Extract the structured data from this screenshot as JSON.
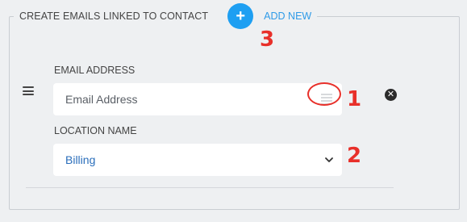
{
  "section": {
    "title": "CREATE EMAILS LINKED TO CONTACT",
    "add_button_icon": "+",
    "add_label": "ADD NEW"
  },
  "email_field": {
    "label": "EMAIL ADDRESS",
    "placeholder": "Email Address",
    "value": ""
  },
  "location_field": {
    "label": "LOCATION NAME",
    "selected": "Billing"
  },
  "annotations": {
    "one": "1",
    "two": "2",
    "three": "3"
  },
  "icons": {
    "drag": "drag-handle-icon",
    "list": "list-icon",
    "remove": "close-circle-icon",
    "chevron": "chevron-down-icon",
    "add": "plus-circle-icon"
  },
  "colors": {
    "accent": "#1e9ff2",
    "link": "#2f9be8",
    "annotation": "#e8302a",
    "select_text": "#2a6ebb"
  }
}
